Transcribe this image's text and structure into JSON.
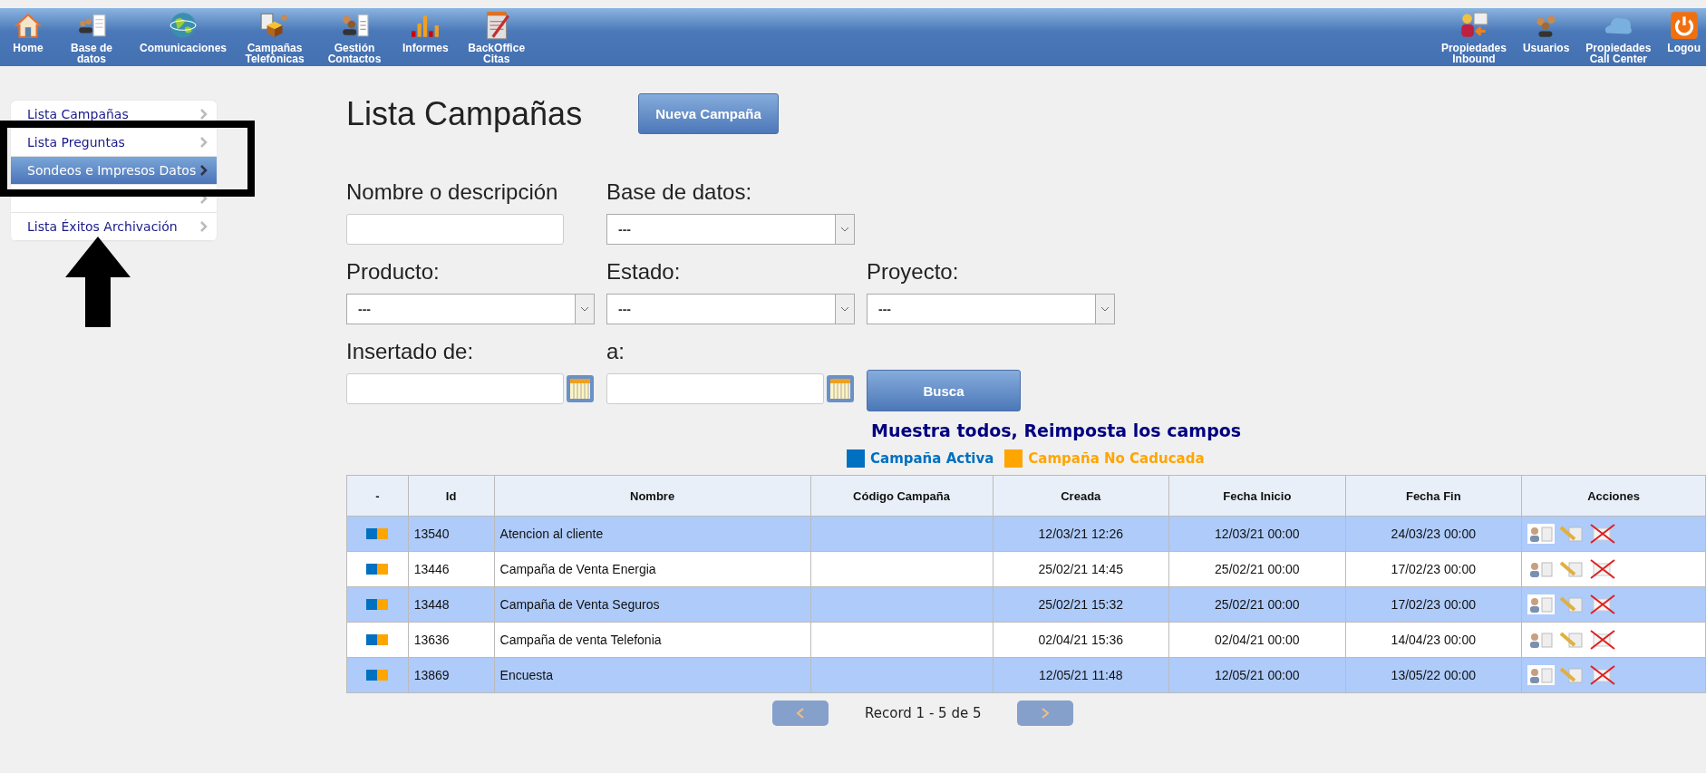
{
  "topbar": {
    "left": [
      {
        "kind": "home",
        "label": "Home"
      },
      {
        "kind": "people-doc",
        "label": "Base de datos"
      },
      {
        "kind": "globe",
        "label": "Comunicaciones"
      },
      {
        "kind": "box",
        "label": "Campañas Telefónicas"
      },
      {
        "kind": "contacts",
        "label": "Gestión Contactos"
      },
      {
        "kind": "chart",
        "label": "Informes"
      },
      {
        "kind": "notepad",
        "label": "BackOffice Citas"
      }
    ],
    "right": [
      {
        "kind": "inbound",
        "label": "Propiedades Inbound"
      },
      {
        "kind": "users",
        "label": "Usuarios"
      },
      {
        "kind": "cloud",
        "label": "Propiedades Call Center"
      },
      {
        "kind": "power",
        "label": "Logou"
      }
    ]
  },
  "sidebar": {
    "items": [
      {
        "label": "Lista Campañas",
        "selected": false
      },
      {
        "label": "Lista Preguntas",
        "selected": false
      },
      {
        "label": "Sondeos e Impresos Datos",
        "selected": true
      },
      {
        "selected": false
      },
      {
        "label": "Lista Éxitos Archivación",
        "selected": false
      }
    ]
  },
  "page": {
    "title": "Lista Campañas",
    "new_button": "Nueva Campaña"
  },
  "filters": [
    {
      "label": "Nombre o descripción",
      "kind": "text"
    },
    {
      "label": "Base de datos:",
      "kind": "select",
      "value": "---"
    },
    {
      "kind": "break"
    },
    {
      "label": "Producto:",
      "kind": "select",
      "value": "---"
    },
    {
      "label": "Estado:",
      "kind": "select",
      "value": "---"
    },
    {
      "label": "Proyecto:",
      "kind": "select",
      "value": "---"
    },
    {
      "label": "Insertado de:",
      "kind": "date"
    },
    {
      "label": "a:",
      "kind": "date"
    },
    {
      "kind": "search",
      "label": "Busca"
    }
  ],
  "reset_link": "Muestra todos, Reimposta los campos",
  "legend": [
    {
      "label": "Campaña Activa",
      "color": "#0070c0"
    },
    {
      "label": "Campaña No Caducada",
      "color": "#ffa500"
    }
  ],
  "table": {
    "columns": [
      "-",
      "Id",
      "Nombre",
      "Código Campaña",
      "Creada",
      "Fecha Inicio",
      "Fecha Fin",
      "Acciones"
    ],
    "rows": [
      {
        "active": true,
        "not_expired": true,
        "id": "13540",
        "name": "Atencion al cliente",
        "created": "12/03/21 12:26",
        "start": "12/03/21 00:00",
        "end": "24/03/23 00:00"
      },
      {
        "active": true,
        "not_expired": true,
        "id": "13446",
        "name": "Campaña de Venta Energia",
        "created": "25/02/21 14:45",
        "start": "25/02/21 00:00",
        "end": "17/02/23 00:00"
      },
      {
        "active": true,
        "not_expired": true,
        "id": "13448",
        "name": "Campaña de Venta Seguros",
        "created": "25/02/21 15:32",
        "start": "25/02/21 00:00",
        "end": "17/02/23 00:00"
      },
      {
        "active": true,
        "not_expired": true,
        "id": "13636",
        "name": "Campaña de venta Telefonia",
        "created": "02/04/21 15:36",
        "start": "02/04/21 00:00",
        "end": "14/04/23 00:00"
      },
      {
        "active": true,
        "not_expired": true,
        "id": "13869",
        "name": "Encuesta",
        "created": "12/05/21 11:48",
        "start": "12/05/21 00:00",
        "end": "13/05/22 00:00"
      }
    ]
  },
  "pagination": {
    "text": "Record 1 - 5 de 5"
  }
}
